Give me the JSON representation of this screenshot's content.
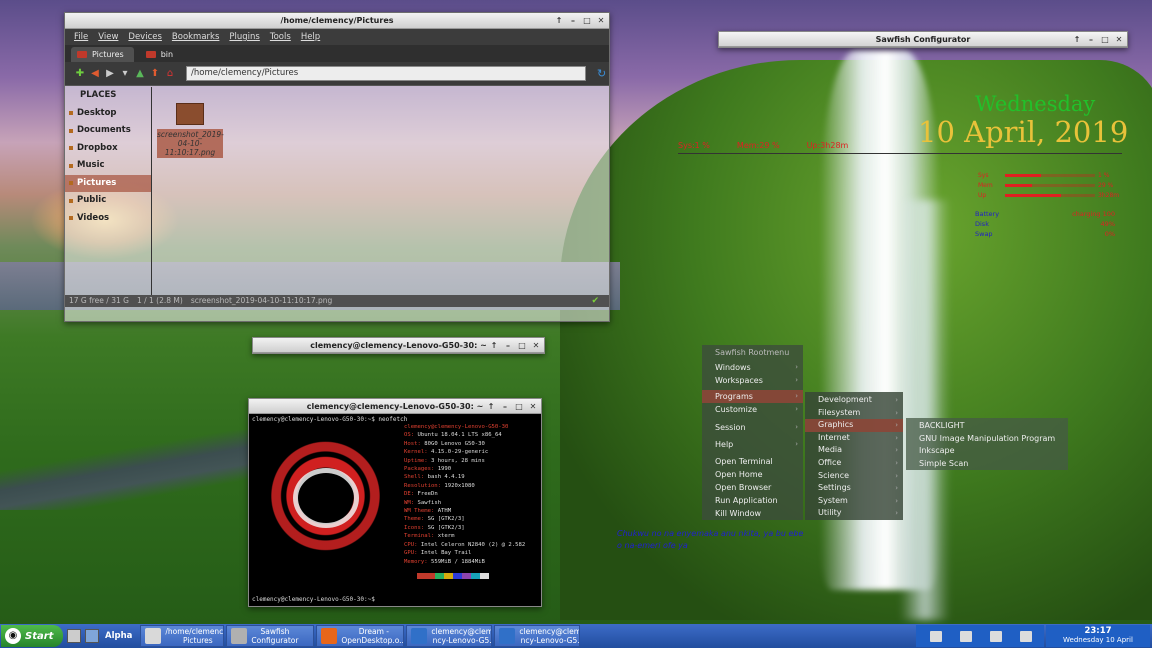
{
  "file_manager": {
    "title": "/home/clemency/Pictures",
    "menu": [
      "File",
      "View",
      "Devices",
      "Bookmarks",
      "Plugins",
      "Tools",
      "Help"
    ],
    "tabs": [
      "Pictures",
      "bin"
    ],
    "path": "/home/clemency/Pictures",
    "sidebar": [
      "PLACES",
      "Desktop",
      "Documents",
      "Dropbox",
      "Music",
      "Pictures",
      "Public",
      "Videos"
    ],
    "selected_sidebar": "Pictures",
    "file_name": "screenshot_2019-04-10-11:10:17.png",
    "status": [
      "17 G free / 31 G",
      "1 / 1 (2.8 M)",
      "screenshot_2019-04-10-11:10:17.png"
    ]
  },
  "sawfish": {
    "title": "Sawfish Configurator"
  },
  "terminal2": {
    "title": "clemency@clemency-Lenovo-G50-30: ~"
  },
  "terminal": {
    "title": "clemency@clemency-Lenovo-G50-30: ~",
    "prompt": "clemency@clemency-Lenovo-G50-30:~$ neofetch",
    "header": "clemency@clemency-Lenovo-G50-30",
    "info": [
      {
        "k": "OS:",
        "v": "Ubuntu 18.04.1 LTS x86_64"
      },
      {
        "k": "Host:",
        "v": "80G0 Lenovo G50-30"
      },
      {
        "k": "Kernel:",
        "v": "4.15.0-29-generic"
      },
      {
        "k": "Uptime:",
        "v": "3 hours, 28 mins"
      },
      {
        "k": "Packages:",
        "v": "1990"
      },
      {
        "k": "Shell:",
        "v": "bash 4.4.19"
      },
      {
        "k": "Resolution:",
        "v": "1920x1080"
      },
      {
        "k": "DE:",
        "v": "FreeDn"
      },
      {
        "k": "WM:",
        "v": "Sawfish"
      },
      {
        "k": "WM Theme:",
        "v": "ATHM"
      },
      {
        "k": "Theme:",
        "v": "SG [GTK2/3]"
      },
      {
        "k": "Icons:",
        "v": "SG [GTK2/3]"
      },
      {
        "k": "Terminal:",
        "v": "xterm"
      },
      {
        "k": "CPU:",
        "v": "Intel Celeron N2840 (2) @ 2.582"
      },
      {
        "k": "GPU:",
        "v": "Intel Bay Trail"
      },
      {
        "k": "Memory:",
        "v": "559MiB / 1884MiB"
      }
    ],
    "palette": [
      "#c0392b",
      "#c0392b",
      "#27ae60",
      "#d4ac0d",
      "#2e3bd8",
      "#8e44ad",
      "#17a2b8",
      "#dddddd"
    ],
    "bottom_prompt": "clemency@clemency-Lenovo-G50-30:~$ "
  },
  "conky": {
    "day": "Wednesday",
    "date": "10 April, 2019",
    "sys": [
      "Sys:1 %",
      "Mem:29 %",
      "Up:3h28m"
    ],
    "bars": [
      {
        "label": "Sys",
        "percent": 40,
        "value": "1 %"
      },
      {
        "label": "Mem",
        "percent": 30,
        "value": "29 %"
      },
      {
        "label": "Up",
        "percent": 62,
        "value": "3h28m"
      }
    ],
    "net": [
      {
        "k": "Battery",
        "v": "charging 100"
      },
      {
        "k": "Disk",
        "v": "49%"
      },
      {
        "k": "Swap",
        "v": "0%"
      }
    ]
  },
  "root_menu": {
    "title": "Sawfish Rootmenu",
    "items": [
      {
        "label": "Windows",
        "sub": true
      },
      {
        "label": "Workspaces",
        "sub": true
      },
      {
        "label": "Programs",
        "sub": true,
        "hl": true
      },
      {
        "label": "Customize",
        "sub": true
      },
      {
        "label": "Session",
        "sub": true
      },
      {
        "label": "Help",
        "sub": true
      },
      {
        "label": "Open Terminal",
        "sub": false
      },
      {
        "label": "Open Home",
        "sub": false
      },
      {
        "label": "Open Browser",
        "sub": false
      },
      {
        "label": "Run Application",
        "sub": false
      },
      {
        "label": "Kill Window",
        "sub": false
      }
    ],
    "programs": [
      "Development",
      "Filesystem",
      "Graphics",
      "Internet",
      "Media",
      "Office",
      "Science",
      "Settings",
      "System",
      "Utility"
    ],
    "highlight_program": "Graphics",
    "graphics": [
      "BACKLIGHT",
      "GNU Image Manipulation Program",
      "Inkscape",
      "Simple Scan"
    ]
  },
  "desktop_text": "Chukwu no na enyemaka anu nkita, ya bu ebe o na-emeri ofe ya",
  "taskbar": {
    "start": "Start",
    "alpha": "Alpha",
    "tasks": [
      {
        "label": "/home/clemency/\nPictures",
        "color": "#d9d9d9"
      },
      {
        "label": "Sawfish\nConfigurator",
        "color": "#b0b0b0"
      },
      {
        "label": "Dream -\nOpenDesktop.o...",
        "color": "#e8661a"
      },
      {
        "label": "clemency@cleme\nncy-Lenovo-G5...",
        "color": "#3070c8"
      },
      {
        "label": "clemency@cleme\nncy-Lenovo-G5...",
        "color": "#3070c8"
      }
    ],
    "time": "23:17",
    "date": "Wednesday 10 April"
  }
}
